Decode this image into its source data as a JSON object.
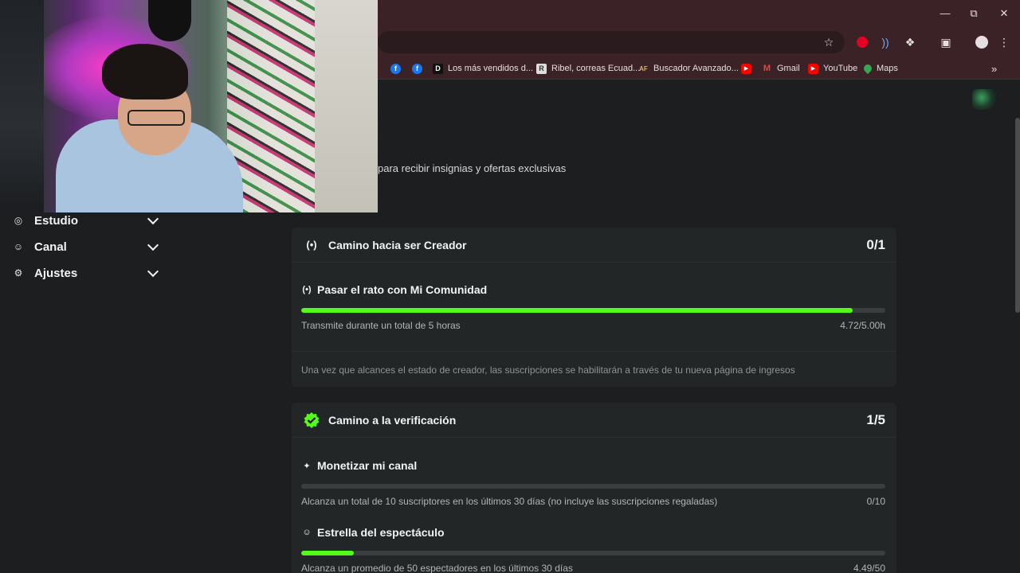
{
  "browser": {
    "bookmarks": [
      {
        "label": "",
        "icon": "facebook-icon",
        "color": "#1877f2"
      },
      {
        "label": "",
        "icon": "facebook-icon",
        "color": "#1877f2"
      },
      {
        "label": "Los más vendidos d...",
        "icon": "d-logo-icon",
        "color": "#111111"
      },
      {
        "label": "Ribel, correas Ecuad...",
        "icon": "r-logo-icon",
        "color": "#dddddd"
      },
      {
        "label": "Buscador Avanzado...",
        "icon": "af-logo-icon",
        "color": "#d8b56a"
      },
      {
        "label": "",
        "icon": "youtube-icon",
        "color": "#ff0000"
      },
      {
        "label": "Gmail",
        "icon": "gmail-icon",
        "color": "#ea4335"
      },
      {
        "label": "YouTube",
        "icon": "youtube-icon",
        "color": "#ff0000"
      },
      {
        "label": "Maps",
        "icon": "maps-icon",
        "color": "#34a853"
      }
    ]
  },
  "page": {
    "promo_text": "para recibir insignias y ofertas exclusivas"
  },
  "sidebar": {
    "items": [
      {
        "label": "Estudio",
        "icon": "studio-icon"
      },
      {
        "label": "Canal",
        "icon": "channel-icon"
      },
      {
        "label": "Ajustes",
        "icon": "gear-icon"
      }
    ]
  },
  "creator_card": {
    "title": "Camino hacia ser Creador",
    "count": "0/1",
    "task": {
      "title": "Pasar el rato con Mi Comunidad",
      "description": "Transmite durante un total de 5 horas",
      "progress_text": "4.72/5.00h",
      "progress": 0.944
    },
    "note": "Una vez que alcances el estado de creador, las suscripciones se habilitarán a través de tu nueva página de ingresos"
  },
  "verification_card": {
    "title": "Camino a la verificación",
    "count": "1/5",
    "tasks": [
      {
        "title": "Monetizar mi canal",
        "description": "Alcanza un total de 10 suscriptores en los últimos 30 días (no incluye las suscripciones regaladas)",
        "progress_text": "0/10",
        "progress": 0.0
      },
      {
        "title": "Estrella del espectáculo",
        "description": "Alcanza un promedio de 50 espectadores en los últimos 30 días",
        "progress_text": "4.49/50",
        "progress": 0.0898
      }
    ]
  },
  "colors": {
    "accent": "#53fc18",
    "track": "#3b3e40",
    "card": "#232627",
    "background": "#1c1e1f",
    "browser_frame": "#3a2227"
  }
}
